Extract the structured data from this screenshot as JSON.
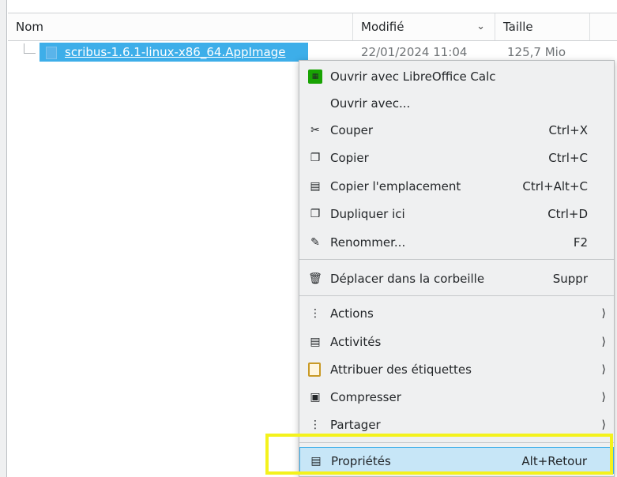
{
  "header": {
    "col_name": "Nom",
    "col_modified": "Modifié",
    "col_size": "Taille"
  },
  "file": {
    "name": "scribus-1.6.1-linux-x86_64.AppImage",
    "modified": "22/01/2024 11:04",
    "size": "125,7 Mio"
  },
  "menu": {
    "items": [
      {
        "label": "Ouvrir avec LibreOffice Calc",
        "shortcut": "",
        "icon": "libreoffice-calc-icon"
      },
      {
        "label": "Ouvrir avec...",
        "shortcut": "",
        "icon": ""
      },
      {
        "label": "Couper",
        "shortcut": "Ctrl+X",
        "icon": "scissors-icon"
      },
      {
        "label": "Copier",
        "shortcut": "Ctrl+C",
        "icon": "copy-icon"
      },
      {
        "label": "Copier l'emplacement",
        "shortcut": "Ctrl+Alt+C",
        "icon": "copy-path-icon"
      },
      {
        "label": "Dupliquer ici",
        "shortcut": "Ctrl+D",
        "icon": "duplicate-icon"
      },
      {
        "label": "Renommer...",
        "shortcut": "F2",
        "icon": "pencil-icon"
      },
      {
        "label": "Déplacer dans la corbeille",
        "shortcut": "Suppr",
        "icon": "trash-icon"
      },
      {
        "label": "Actions",
        "shortcut": "",
        "icon": "more-vertical-icon",
        "submenu": true
      },
      {
        "label": "Activités",
        "shortcut": "",
        "icon": "activities-icon",
        "submenu": true
      },
      {
        "label": "Attribuer des étiquettes",
        "shortcut": "",
        "icon": "tag-icon",
        "submenu": true
      },
      {
        "label": "Compresser",
        "shortcut": "",
        "icon": "archive-icon",
        "submenu": true
      },
      {
        "label": "Partager",
        "shortcut": "",
        "icon": "share-icon",
        "submenu": true
      },
      {
        "label": "Propriétés",
        "shortcut": "Alt+Retour",
        "icon": "properties-icon",
        "active": true
      }
    ]
  },
  "colors": {
    "selection": "#3daee9",
    "menu_bg": "#eff0f1",
    "active_item_bg": "#c7e6f7",
    "highlight_box": "#f4f21c"
  }
}
